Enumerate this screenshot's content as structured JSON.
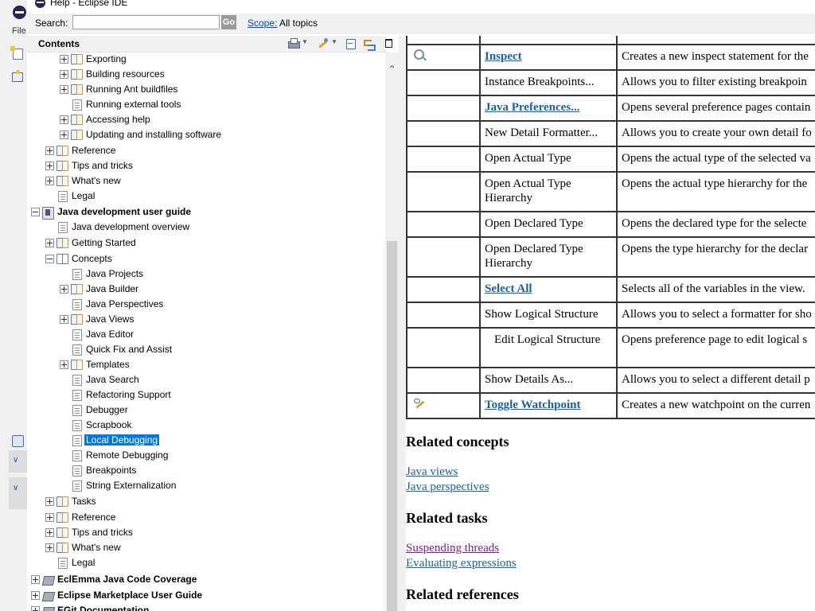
{
  "window": {
    "title": "Help - Eclipse IDE"
  },
  "background_window": {
    "menu_file": "File"
  },
  "search": {
    "label": "Search:",
    "value": "",
    "go_label": "Go",
    "scope_link": "Scope:",
    "scope_value": "All topics"
  },
  "contents": {
    "title": "Contents"
  },
  "toolbar_icons": [
    "print-icon",
    "highlight-search-icon",
    "collapse-all-icon",
    "link-with-contents-icon",
    "maximize-icon"
  ],
  "tree": [
    {
      "label": "Exporting",
      "level": 2,
      "toggle": "plus",
      "icon": "book"
    },
    {
      "label": "Building resources",
      "level": 2,
      "toggle": "plus",
      "icon": "book"
    },
    {
      "label": "Running Ant buildfiles",
      "level": 2,
      "toggle": "plus",
      "icon": "book"
    },
    {
      "label": "Running external tools",
      "level": 2,
      "toggle": "",
      "icon": "topic"
    },
    {
      "label": "Accessing help",
      "level": 2,
      "toggle": "plus",
      "icon": "book"
    },
    {
      "label": "Updating and installing software",
      "level": 2,
      "toggle": "plus",
      "icon": "book"
    },
    {
      "label": "Reference",
      "level": 1,
      "toggle": "plus",
      "icon": "book"
    },
    {
      "label": "Tips and tricks",
      "level": 1,
      "toggle": "plus",
      "icon": "book"
    },
    {
      "label": "What's new",
      "level": 1,
      "toggle": "plus",
      "icon": "book"
    },
    {
      "label": "Legal",
      "level": 1,
      "toggle": "",
      "icon": "topic"
    },
    {
      "label": "Java development user guide",
      "level": 0,
      "toggle": "minus",
      "icon": "guide",
      "bold": true
    },
    {
      "label": "Java development overview",
      "level": 1,
      "toggle": "",
      "icon": "topic"
    },
    {
      "label": "Getting Started",
      "level": 1,
      "toggle": "plus",
      "icon": "book"
    },
    {
      "label": "Concepts",
      "level": 1,
      "toggle": "minus",
      "icon": "book"
    },
    {
      "label": "Java Projects",
      "level": 2,
      "toggle": "",
      "icon": "topic"
    },
    {
      "label": "Java Builder",
      "level": 2,
      "toggle": "plus",
      "icon": "book"
    },
    {
      "label": "Java Perspectives",
      "level": 2,
      "toggle": "",
      "icon": "topic"
    },
    {
      "label": "Java Views",
      "level": 2,
      "toggle": "plus",
      "icon": "book"
    },
    {
      "label": "Java Editor",
      "level": 2,
      "toggle": "",
      "icon": "topic"
    },
    {
      "label": "Quick Fix and Assist",
      "level": 2,
      "toggle": "",
      "icon": "topic"
    },
    {
      "label": "Templates",
      "level": 2,
      "toggle": "plus",
      "icon": "book"
    },
    {
      "label": "Java Search",
      "level": 2,
      "toggle": "",
      "icon": "topic"
    },
    {
      "label": "Refactoring Support",
      "level": 2,
      "toggle": "",
      "icon": "topic"
    },
    {
      "label": "Debugger",
      "level": 2,
      "toggle": "",
      "icon": "topic"
    },
    {
      "label": "Scrapbook",
      "level": 2,
      "toggle": "",
      "icon": "topic"
    },
    {
      "label": "Local Debugging",
      "level": 2,
      "toggle": "",
      "icon": "topic",
      "selected": true
    },
    {
      "label": "Remote Debugging",
      "level": 2,
      "toggle": "",
      "icon": "topic"
    },
    {
      "label": "Breakpoints",
      "level": 2,
      "toggle": "",
      "icon": "topic"
    },
    {
      "label": "String Externalization",
      "level": 2,
      "toggle": "",
      "icon": "topic"
    },
    {
      "label": "Tasks",
      "level": 1,
      "toggle": "plus",
      "icon": "book"
    },
    {
      "label": "Reference",
      "level": 1,
      "toggle": "plus",
      "icon": "book"
    },
    {
      "label": "Tips and tricks",
      "level": 1,
      "toggle": "plus",
      "icon": "book"
    },
    {
      "label": "What's new",
      "level": 1,
      "toggle": "plus",
      "icon": "book"
    },
    {
      "label": "Legal",
      "level": 1,
      "toggle": "",
      "icon": "topic"
    },
    {
      "label": "EclEmma Java Code Coverage",
      "level": 0,
      "toggle": "plus",
      "icon": "plugin",
      "bold": true
    },
    {
      "label": "Eclipse Marketplace User Guide",
      "level": 0,
      "toggle": "plus",
      "icon": "plugin",
      "bold": true
    },
    {
      "label": "EGit Documentation",
      "level": 0,
      "toggle": "plus",
      "icon": "plugin",
      "bold": true
    }
  ],
  "table": [
    {
      "icon": "",
      "command": "",
      "command_link": true,
      "description": ""
    },
    {
      "icon": "inspect-icon",
      "command": "Inspect",
      "command_link": true,
      "description": "Creates a new inspect statement for the"
    },
    {
      "icon": "",
      "command": "Instance Breakpoints...",
      "command_link": false,
      "description": "Allows you to filter existing breakpoin"
    },
    {
      "icon": "",
      "command": "Java Preferences...",
      "command_link": true,
      "description": "Opens several preference pages contain"
    },
    {
      "icon": "",
      "command": "New Detail Formatter...",
      "command_link": false,
      "description": "Allows you to create your own detail fo"
    },
    {
      "icon": "",
      "command": "Open Actual Type",
      "command_link": false,
      "description": "Opens the actual type of the selected va"
    },
    {
      "icon": "",
      "command": "Open Actual Type Hierarchy",
      "command_link": false,
      "description": "Opens the actual type hierarchy for the"
    },
    {
      "icon": "",
      "command": "Open Declared Type",
      "command_link": false,
      "description": "Opens the declared type for the selecte"
    },
    {
      "icon": "",
      "command": "Open Declared Type Hierarchy",
      "command_link": false,
      "description": "Opens the type hierarchy for the declar"
    },
    {
      "icon": "",
      "command": "Select All",
      "command_link": true,
      "description": "Selects all of the variables in the view."
    },
    {
      "icon": "",
      "command": "Show Logical Structure",
      "command_link": false,
      "description": "Allows you to select a formatter for sho"
    },
    {
      "icon": "",
      "command": "  Edit Logical Structure",
      "command_link": false,
      "description": "Opens preference page to edit logical s",
      "tall": true
    },
    {
      "icon": "",
      "command": "Show Details As...",
      "command_link": false,
      "description": "Allows you to select a different detail p"
    },
    {
      "icon": "toggle-watchpoint-icon",
      "command": "Toggle Watchpoint",
      "command_link": true,
      "description": "Creates a new watchpoint on the curren"
    }
  ],
  "related": {
    "concepts_heading": "Related concepts",
    "concepts": [
      "Java views",
      "Java perspectives"
    ],
    "tasks_heading": "Related tasks",
    "tasks": [
      {
        "label": "Suspending threads",
        "visited": true
      },
      {
        "label": "Evaluating expressions",
        "visited": false
      }
    ],
    "references_heading": "Related references"
  }
}
